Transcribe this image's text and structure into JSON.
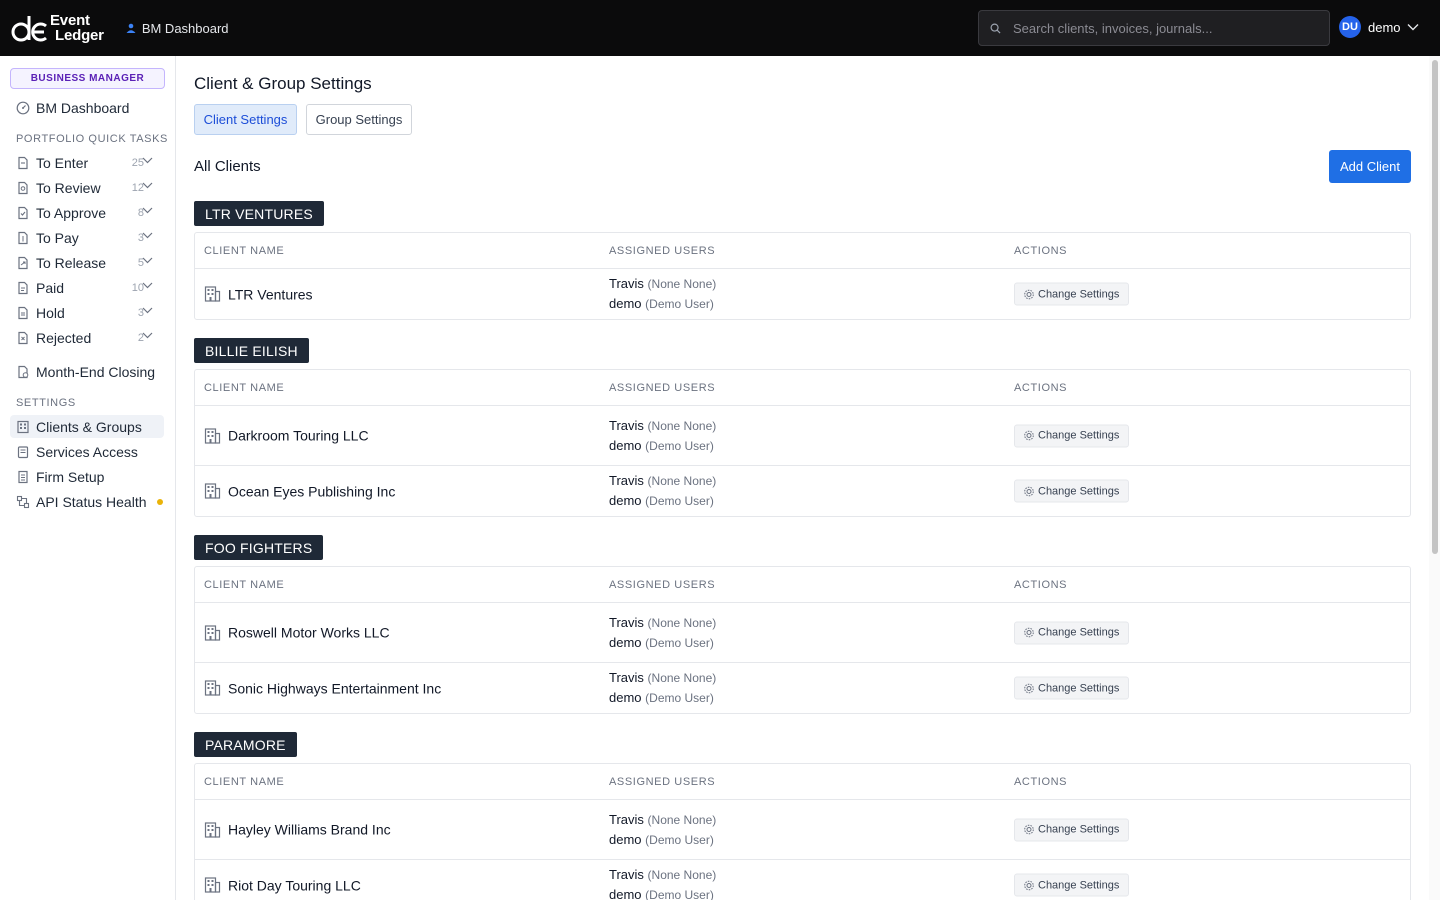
{
  "header": {
    "brand_line1": "Event",
    "brand_line2": "Ledger",
    "breadcrumb": "BM Dashboard",
    "search_placeholder": "Search clients, invoices, journals...",
    "user_initials": "DU",
    "user_name": "demo"
  },
  "sidebar": {
    "badge": "BUSINESS MANAGER",
    "dashboard": "BM Dashboard",
    "quick_tasks_label": "PORTFOLIO QUICK TASKS",
    "tasks": [
      {
        "label": "To Enter",
        "count": "25"
      },
      {
        "label": "To Review",
        "count": "12"
      },
      {
        "label": "To Approve",
        "count": "8"
      },
      {
        "label": "To Pay",
        "count": "3"
      },
      {
        "label": "To Release",
        "count": "5"
      },
      {
        "label": "Paid",
        "count": "10"
      },
      {
        "label": "Hold",
        "count": "3"
      },
      {
        "label": "Rejected",
        "count": "2"
      }
    ],
    "month_end": "Month-End Closing",
    "settings_label": "SETTINGS",
    "settings": [
      {
        "label": "Clients & Groups"
      },
      {
        "label": "Services Access"
      },
      {
        "label": "Firm Setup"
      },
      {
        "label": "API Status Health"
      }
    ]
  },
  "main": {
    "title": "Client & Group Settings",
    "tabs": [
      "Client Settings",
      "Group Settings"
    ],
    "all_clients": "All Clients",
    "add_client": "Add Client",
    "columns": [
      "CLIENT NAME",
      "ASSIGNED USERS",
      "ACTIONS"
    ],
    "action_label": "Change Settings",
    "user1_name": "Travis",
    "user1_role": "(None None)",
    "user2_name": "demo",
    "user2_role": "(Demo User)",
    "groups": [
      {
        "name": "LTR VENTURES",
        "clients": [
          "LTR Ventures"
        ]
      },
      {
        "name": "BILLIE EILISH",
        "clients": [
          "Darkroom Touring LLC",
          "Ocean Eyes Publishing Inc"
        ]
      },
      {
        "name": "FOO FIGHTERS",
        "clients": [
          "Roswell Motor Works LLC",
          "Sonic Highways Entertainment Inc"
        ]
      },
      {
        "name": "PARAMORE",
        "clients": [
          "Hayley Williams Brand Inc",
          "Riot Day Touring LLC"
        ]
      }
    ]
  },
  "colors": {
    "accent": "#1f6fe5",
    "group_label_bg": "#1f2937",
    "status_dot": "#eab308",
    "topbar_bg": "#0b0b0c"
  }
}
